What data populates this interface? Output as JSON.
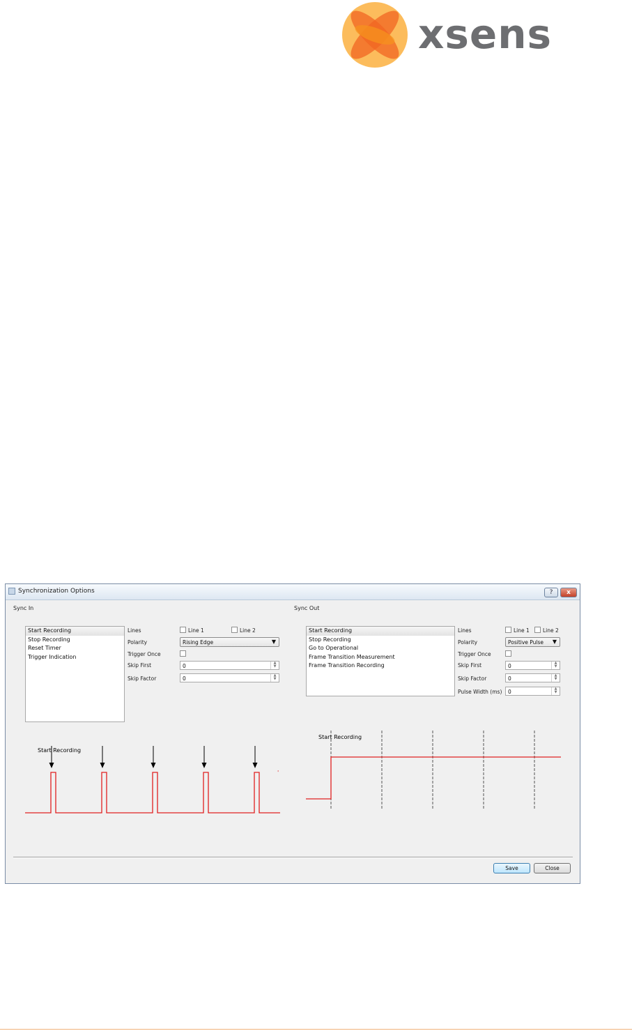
{
  "brand": {
    "name": "xsens",
    "colors": {
      "orange": "#f7941d",
      "gray": "#6d6e71"
    }
  },
  "dialog": {
    "title": "Synchronization Options",
    "help_label": "?",
    "close_label": "x",
    "save_label": "Save",
    "close_button_label": "Close"
  },
  "sync_in": {
    "label": "Sync In",
    "items": [
      "Start Recording",
      "Stop Recording",
      "Reset Timer",
      "Trigger Indication"
    ],
    "selected_index": 0,
    "lines_label": "Lines",
    "line1_label": "Line 1",
    "line2_label": "Line 2",
    "line1_checked": false,
    "line2_checked": false,
    "polarity_label": "Polarity",
    "polarity_value": "Rising Edge",
    "trigger_once_label": "Trigger Once",
    "trigger_once_checked": false,
    "skip_first_label": "Skip First",
    "skip_first_value": "0",
    "skip_factor_label": "Skip Factor",
    "skip_factor_value": "0",
    "diagram_label": "Start Recording",
    "signal_color": "#e02020"
  },
  "sync_out": {
    "label": "Sync Out",
    "items": [
      "Start Recording",
      "Stop Recording",
      "Go to Operational",
      "Frame Transition Measurement",
      "Frame Transition Recording"
    ],
    "selected_index": 0,
    "lines_label": "Lines",
    "line1_label": "Line 1",
    "line2_label": "Line 2",
    "line1_checked": false,
    "line2_checked": false,
    "polarity_label": "Polarity",
    "polarity_value": "Positive Pulse",
    "trigger_once_label": "Trigger Once",
    "trigger_once_checked": false,
    "skip_first_label": "Skip First",
    "skip_first_value": "0",
    "skip_factor_label": "Skip Factor",
    "skip_factor_value": "0",
    "pulse_width_label": "Pulse Width (ms)",
    "pulse_width_value": "0",
    "diagram_label": "Start Recording",
    "signal_color": "#e02020"
  }
}
